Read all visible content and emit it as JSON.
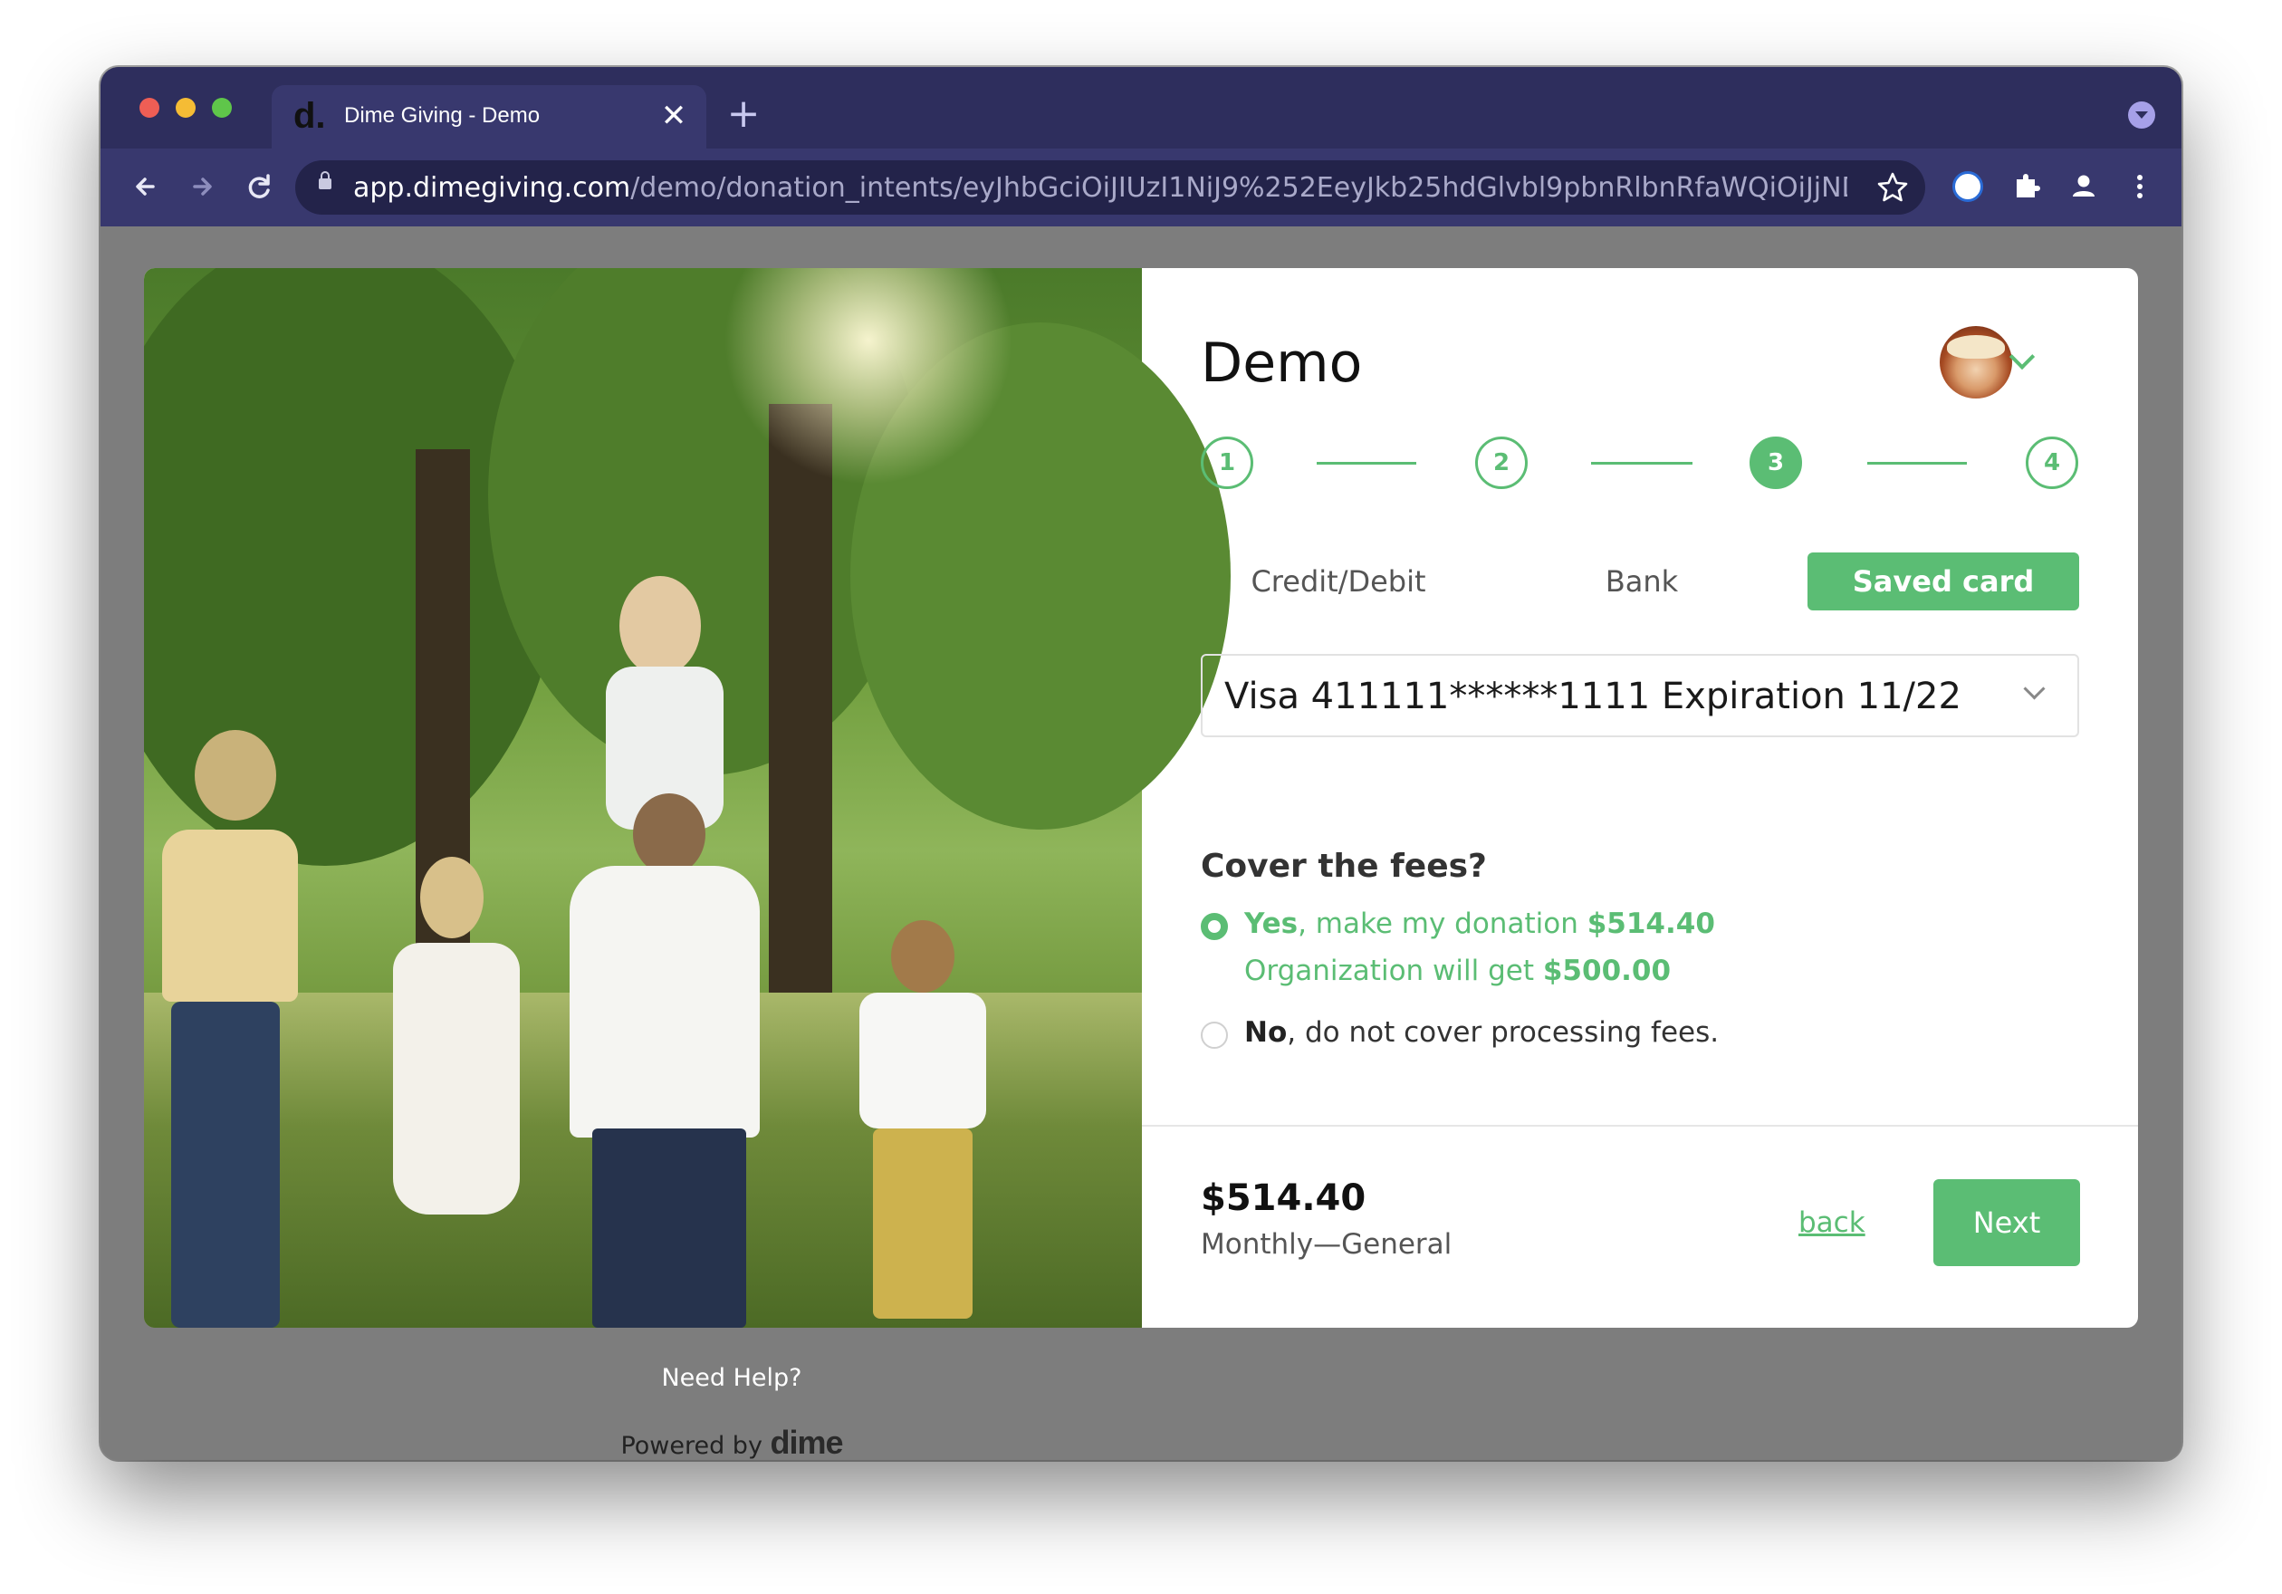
{
  "browser": {
    "tab_title": "Dime Giving - Demo",
    "tab_favicon": "d.",
    "close_glyph": "✕",
    "new_tab_glyph": "+",
    "url_host": "app.dimegiving.com",
    "url_path": "/demo/donation_intents/eyJhbGciOiJIUzI1NiJ9%252EeyJkb25hdGlvbl9pbnRlbnRfaWQiOiJjNDNkODcxZ...",
    "icons": {
      "back": "arrow-left-icon",
      "forward": "arrow-right-icon",
      "reload": "reload-icon",
      "star": "star-icon",
      "extensions": "puzzle-icon",
      "menu": "kebab-menu-icon"
    }
  },
  "form": {
    "org_name": "Demo",
    "steps": [
      "1",
      "2",
      "3",
      "4"
    ],
    "active_step": 3,
    "payment_tabs": [
      "Credit/Debit",
      "Bank",
      "Saved card"
    ],
    "active_payment_tab": "Saved card",
    "saved_card_value": "Visa 411111******1111 Expiration 11/22",
    "cover_fees": {
      "title": "Cover the fees?",
      "yes_bold": "Yes",
      "yes_text": ", make my donation ",
      "yes_amount": "$514.40",
      "org_text": "Organization will get ",
      "org_amount": "$500.00",
      "no_bold": "No",
      "no_text": ", do not cover processing fees.",
      "selected": "yes"
    },
    "footer": {
      "total": "$514.40",
      "summary": "Monthly—General",
      "back_label": "back",
      "next_label": "Next"
    }
  },
  "page_footer": {
    "help": "Need Help?",
    "powered_prefix": "Powered by ",
    "powered_logo": "dime"
  },
  "colors": {
    "accent": "#5bbd74",
    "chrome": "#2e2e5d",
    "backdrop": "#7d7d7d"
  }
}
